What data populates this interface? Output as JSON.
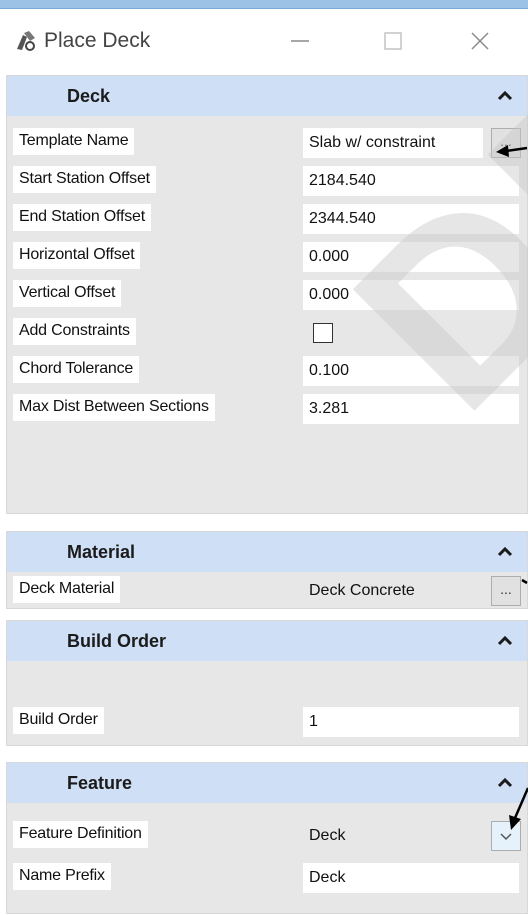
{
  "window": {
    "title": "Place Deck",
    "minimize_glyph": "—",
    "close_glyph": "✕"
  },
  "sections": {
    "deck": {
      "title": "Deck",
      "template_name_label": "Template Name",
      "template_name_value": "Slab w/ constraint",
      "start_station_offset_label": "Start Station Offset",
      "start_station_offset_value": "2184.540",
      "end_station_offset_label": "End Station Offset",
      "end_station_offset_value": "2344.540",
      "horizontal_offset_label": "Horizontal Offset",
      "horizontal_offset_value": "0.000",
      "vertical_offset_label": "Vertical Offset",
      "vertical_offset_value": "0.000",
      "add_constraints_label": "Add Constraints",
      "chord_tolerance_label": "Chord Tolerance",
      "chord_tolerance_value": "0.100",
      "max_dist_label": "Max Dist Between Sections",
      "max_dist_value": "3.281"
    },
    "material": {
      "title": "Material",
      "deck_material_label": "Deck Material",
      "deck_material_value": "Deck Concrete"
    },
    "build_order": {
      "title": "Build Order",
      "build_order_label": "Build Order",
      "build_order_value": "1"
    },
    "feature": {
      "title": "Feature",
      "feature_definition_label": "Feature Definition",
      "feature_definition_value": "Deck",
      "name_prefix_label": "Name Prefix",
      "name_prefix_value": "Deck"
    }
  },
  "browse_button_label": "...",
  "watermark_text": "DR",
  "icons": {
    "app": "place-deck-icon",
    "collapse": "chevron-up-icon",
    "dropdown": "chevron-down-icon"
  },
  "colors": {
    "section_header": "#cfe0f6",
    "panel_bg": "#e7e7e7",
    "top_strip": "#9cc3e6",
    "annotation_arrow": "#000000"
  }
}
